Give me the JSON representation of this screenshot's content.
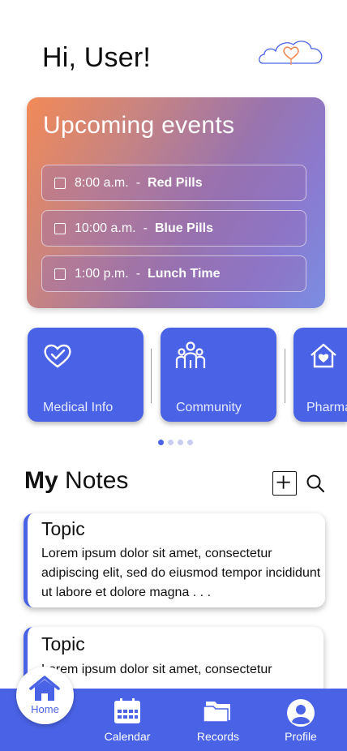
{
  "header": {
    "greeting": "Hi, User!",
    "logo_icon": "cloud-heart-icon"
  },
  "events": {
    "title": "Upcoming events",
    "items": [
      {
        "time": "8:00 a.m.",
        "separator": "-",
        "name": "Red Pills",
        "checked": false
      },
      {
        "time": "10:00 a.m.",
        "separator": "-",
        "name": "Blue Pills",
        "checked": false
      },
      {
        "time": "1:00 p.m.",
        "separator": "-",
        "name": "Lunch Time",
        "checked": false
      }
    ]
  },
  "tiles": [
    {
      "label": "Medical Info",
      "icon": "heart-check-icon"
    },
    {
      "label": "Community",
      "icon": "people-icon"
    },
    {
      "label": "Pharmacy",
      "icon": "house-heart-icon"
    }
  ],
  "carousel": {
    "pages": 4,
    "active": 0
  },
  "notes": {
    "title_bold": "My",
    "title_rest": "Notes",
    "add_icon": "plus-icon",
    "search_icon": "search-icon",
    "items": [
      {
        "topic": "Topic",
        "body": "Lorem ipsum dolor sit amet, consectetur adipiscing elit, sed do eiusmod tempor incididunt ut labore et dolore magna . . ."
      },
      {
        "topic": "Topic",
        "body": "Lorem ipsum dolor sit amet, consectetur"
      }
    ]
  },
  "nav": {
    "items": [
      {
        "label": "Home",
        "icon": "home-icon",
        "active": true
      },
      {
        "label": "Calendar",
        "icon": "calendar-icon"
      },
      {
        "label": "Records",
        "icon": "folder-icon"
      },
      {
        "label": "Profile",
        "icon": "user-icon"
      }
    ]
  },
  "colors": {
    "primary": "#4a63e6",
    "gradient_start": "#f28a57",
    "gradient_end": "#7a8ee2",
    "logo_outline": "#4a63e6",
    "logo_heart": "#f28a57"
  }
}
